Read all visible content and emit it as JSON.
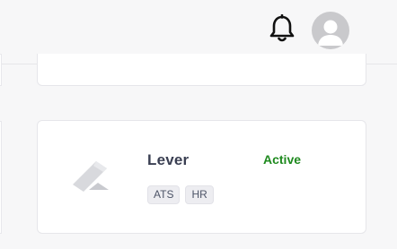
{
  "header": {
    "notifications_icon": "bell-icon",
    "avatar_icon": "user-avatar-icon"
  },
  "integration": {
    "name": "Lever",
    "status": "Active",
    "status_color": "#1f8a1f",
    "logo_icon": "lever-logo",
    "tags": [
      "ATS",
      "HR"
    ]
  }
}
